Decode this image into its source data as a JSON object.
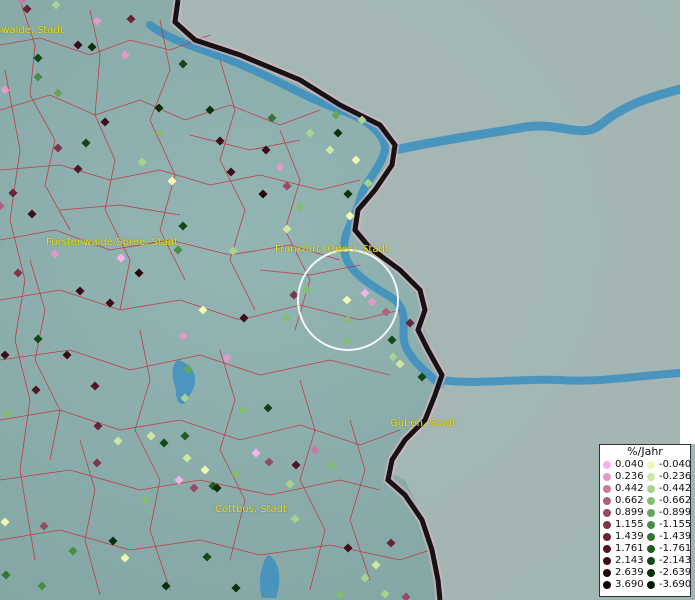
{
  "map": {
    "cities": [
      {
        "id": "eberswalde",
        "label": "swalde, Stadt"
      },
      {
        "id": "fuerstenwalde",
        "label": "Fürstenwalde/Spree, Stadt"
      },
      {
        "id": "frankfurt",
        "label": "Frankfurt (Oder), Stadt"
      },
      {
        "id": "guben",
        "label": "Guben, Stadt"
      },
      {
        "id": "cottbus",
        "label": "Cottbus, Stadt"
      }
    ]
  },
  "legend": {
    "title": "%/Jahr",
    "positive": [
      {
        "value": "0.040",
        "color": "#f5b3ea"
      },
      {
        "value": "0.236",
        "color": "#e39ac8"
      },
      {
        "value": "0.442",
        "color": "#c97aa3"
      },
      {
        "value": "0.662",
        "color": "#b0607f"
      },
      {
        "value": "0.899",
        "color": "#974a63"
      },
      {
        "value": "1.155",
        "color": "#7e354c"
      },
      {
        "value": "1.439",
        "color": "#662537"
      },
      {
        "value": "1.761",
        "color": "#4f1726"
      },
      {
        "value": "2.143",
        "color": "#3a0d18"
      },
      {
        "value": "2.639",
        "color": "#26060e"
      },
      {
        "value": "3.690",
        "color": "#120205"
      }
    ],
    "negative": [
      {
        "value": "-0.040",
        "color": "#f2f7b2"
      },
      {
        "value": "-0.236",
        "color": "#cfe6a2"
      },
      {
        "value": "-0.442",
        "color": "#a8d38c"
      },
      {
        "value": "-0.662",
        "color": "#84bd72"
      },
      {
        "value": "-0.899",
        "color": "#64a65a"
      },
      {
        "value": "-1.155",
        "color": "#488f45"
      },
      {
        "value": "-1.439",
        "color": "#327632"
      },
      {
        "value": "-1.761",
        "color": "#215e22"
      },
      {
        "value": "-2.143",
        "color": "#144716"
      },
      {
        "value": "-2.639",
        "color": "#0a300c"
      },
      {
        "value": "-3.690",
        "color": "#031a05"
      }
    ]
  }
}
